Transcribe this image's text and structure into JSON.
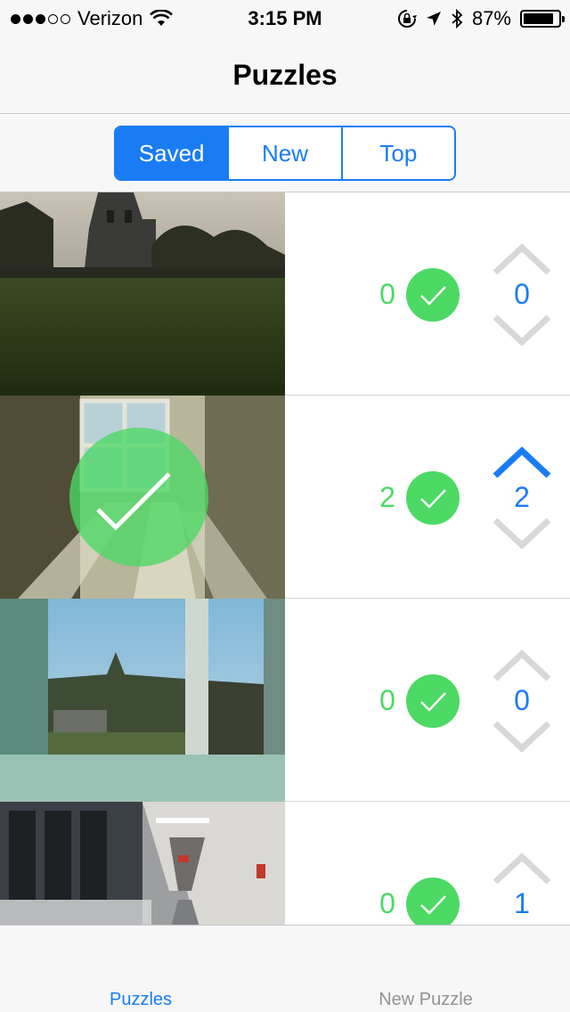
{
  "status_bar": {
    "carrier": "Verizon",
    "time": "3:15 PM",
    "battery_percent": "87%",
    "battery_level": 0.87,
    "signal_bars_filled": 3,
    "signal_bars_total": 5,
    "icons": [
      "wifi-icon",
      "rotation-lock-icon",
      "location-arrow-icon",
      "bluetooth-icon",
      "battery-icon"
    ]
  },
  "nav": {
    "title": "Puzzles"
  },
  "segments": {
    "items": [
      {
        "label": "Saved",
        "selected": true
      },
      {
        "label": "New",
        "selected": false
      },
      {
        "label": "Top",
        "selected": false
      }
    ]
  },
  "puzzles": [
    {
      "solved_count": "0",
      "score": "0",
      "upvoted": false,
      "solved_by_me": false,
      "thumbnail": "campus lawn with stone building at dusk"
    },
    {
      "solved_count": "2",
      "score": "2",
      "upvoted": true,
      "solved_by_me": true,
      "thumbnail": "sunlit window casting shadows in hallway"
    },
    {
      "solved_count": "0",
      "score": "0",
      "upvoted": false,
      "solved_by_me": false,
      "thumbnail": "view of campus through glass windows"
    },
    {
      "solved_count": "0",
      "score": "1",
      "upvoted": false,
      "solved_by_me": false,
      "thumbnail": "indoor corridor with windows"
    }
  ],
  "tab_bar": {
    "items": [
      {
        "label": "Puzzles",
        "active": true
      },
      {
        "label": "New Puzzle",
        "active": false
      }
    ]
  },
  "colors": {
    "accent": "#1a7cf5",
    "check_green": "#4cd964",
    "chevron_gray": "#d8d8d8",
    "bar_background": "#f7f7f7"
  }
}
